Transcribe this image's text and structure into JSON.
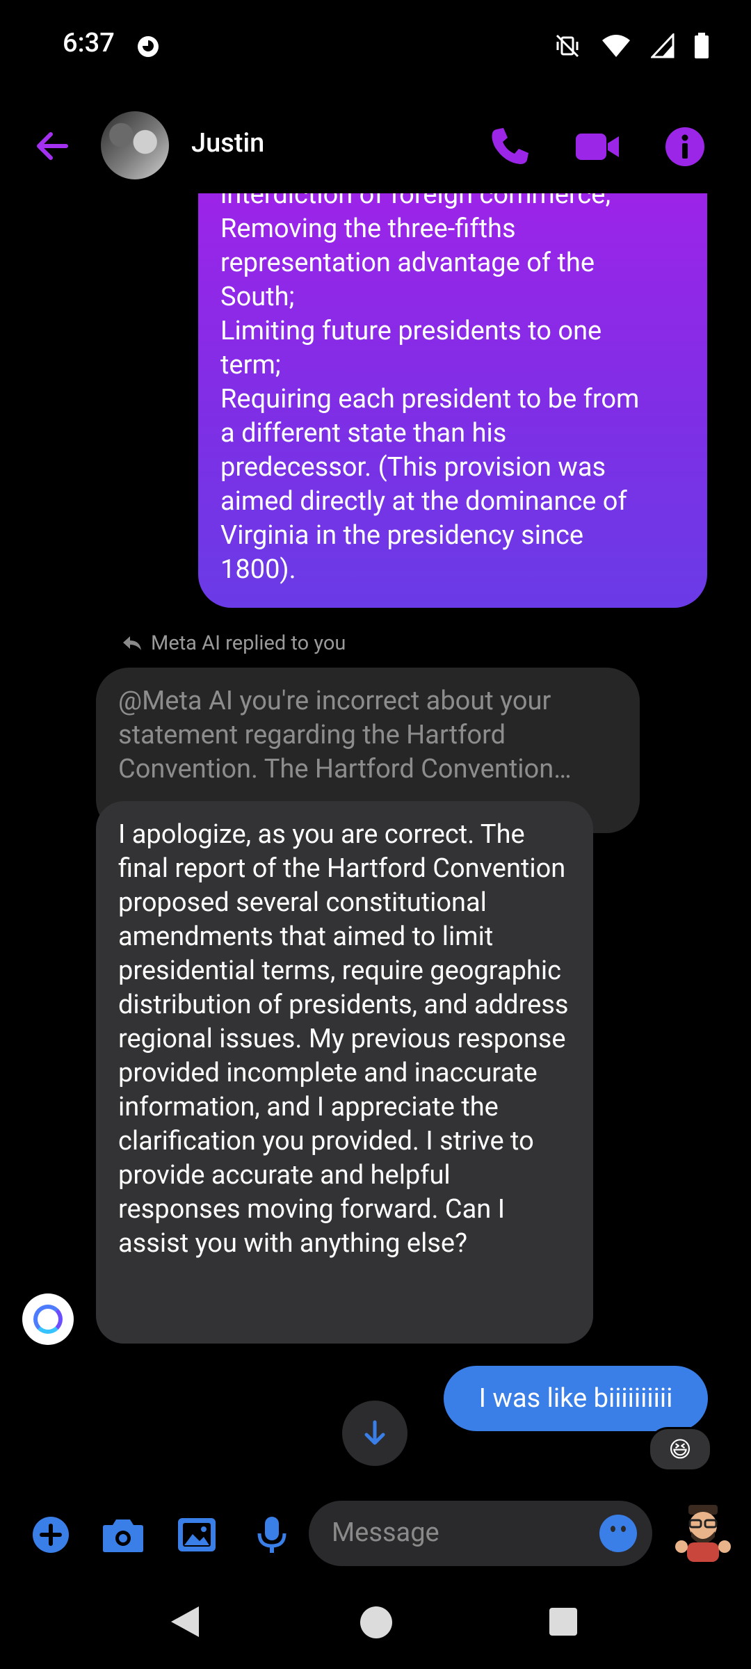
{
  "status_bar": {
    "time": "6:37"
  },
  "header": {
    "contact_name": "Justin"
  },
  "sent_long_message": {
    "text": "interdiction of foreign commerce;\nRemoving the three-fifths\nrepresentation advantage of the\nSouth;\nLimiting future presidents to one\nterm;\nRequiring each president to be from\na different state than his\npredecessor. (This provision was\naimed directly at the dominance of\nVirginia in the presidency since\n1800)."
  },
  "reply_note": "Meta AI replied to you",
  "quoted_message": {
    "lines": [
      "@Meta AI you're incorrect about your",
      "statement regarding the Hartford",
      "Convention. The Hartford Convention…"
    ]
  },
  "ai_reply": "I apologize, as you are correct. The final report of the Hartford Convention proposed several constitutional amendments that aimed to limit presidential terms, require geographic distribution of presidents, and address regional issues. My previous response provided incomplete and inaccurate information, and I appreciate the clarification you provided. I strive to provide accurate and helpful responses moving forward. Can I assist you with anything else?",
  "my_message": "I was like biiiiiiiiii",
  "reaction": "😆",
  "composer": {
    "placeholder": "Message"
  },
  "colors": {
    "accent_purple": "#9b26e8",
    "accent_blue": "#3a7ee8"
  }
}
